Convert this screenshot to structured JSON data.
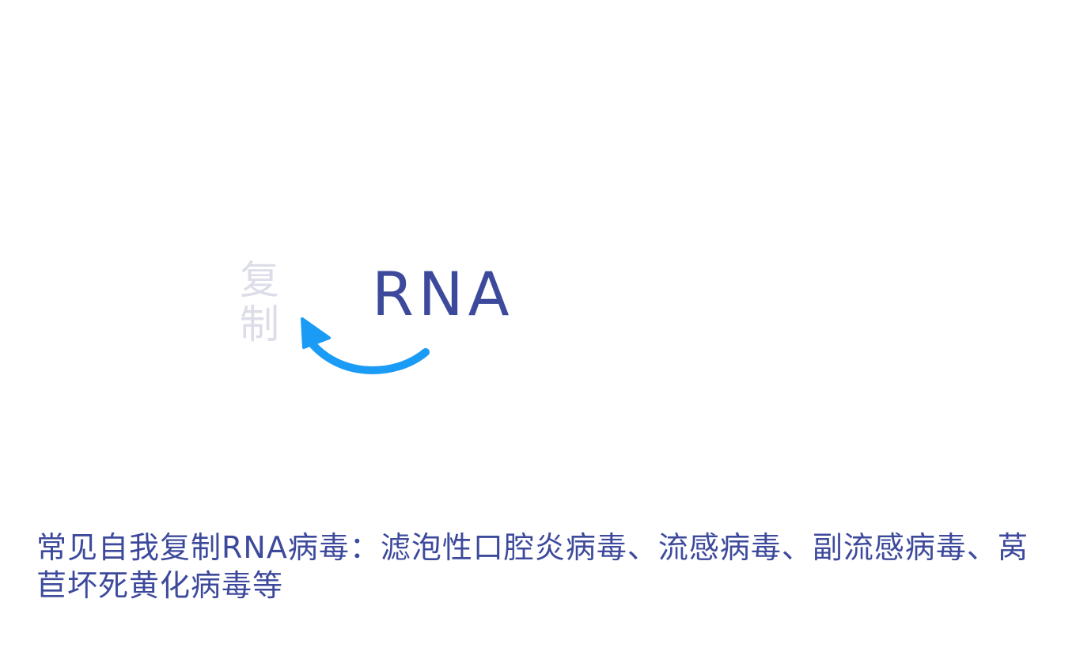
{
  "diagram": {
    "node_label": "RNA",
    "arrow_label": "复制",
    "arrow_color": "#1a9bf5",
    "text_color": "#3d4a9c",
    "arrow_label_color": "#dcdde8"
  },
  "caption": {
    "text": "常见自我复制RNA病毒：滤泡性口腔炎病毒、流感病毒、副流感病毒、莴苣坏死黄化病毒等"
  }
}
